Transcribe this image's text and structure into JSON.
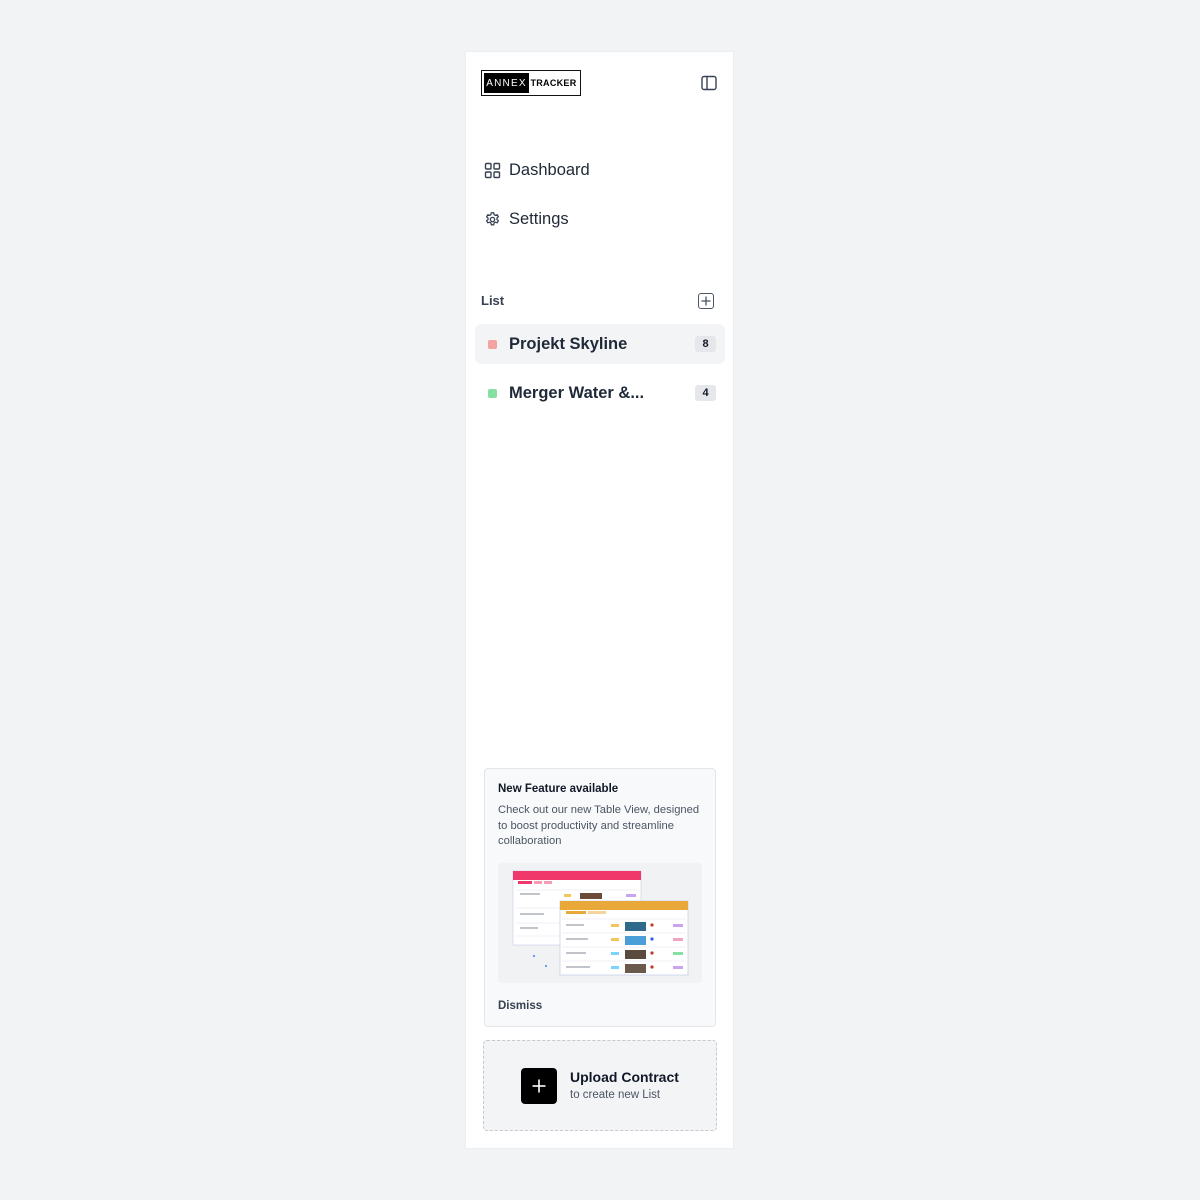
{
  "brand": {
    "logo_left": "ANNEX",
    "logo_right": "TRACKER"
  },
  "nav": [
    {
      "label": "Dashboard",
      "icon": "grid-icon"
    },
    {
      "label": "Settings",
      "icon": "gear-icon"
    }
  ],
  "list_section": {
    "title": "List",
    "items": [
      {
        "label": "Projekt Skyline",
        "count": "8",
        "color": "#f4a3a3",
        "active": true
      },
      {
        "label": "Merger Water &...",
        "count": "4",
        "color": "#86e0a2",
        "active": false
      }
    ]
  },
  "feature_card": {
    "title": "New Feature available",
    "description": "Check out our new Table View, designed to boost productivity and streamline collaboration",
    "dismiss_label": "Dismiss"
  },
  "upload": {
    "title": "Upload Contract",
    "subtitle": "to create new List"
  },
  "colors": {
    "accent_pink": "#f0386b",
    "accent_amber": "#e9a93a",
    "text": "#1f2937"
  }
}
